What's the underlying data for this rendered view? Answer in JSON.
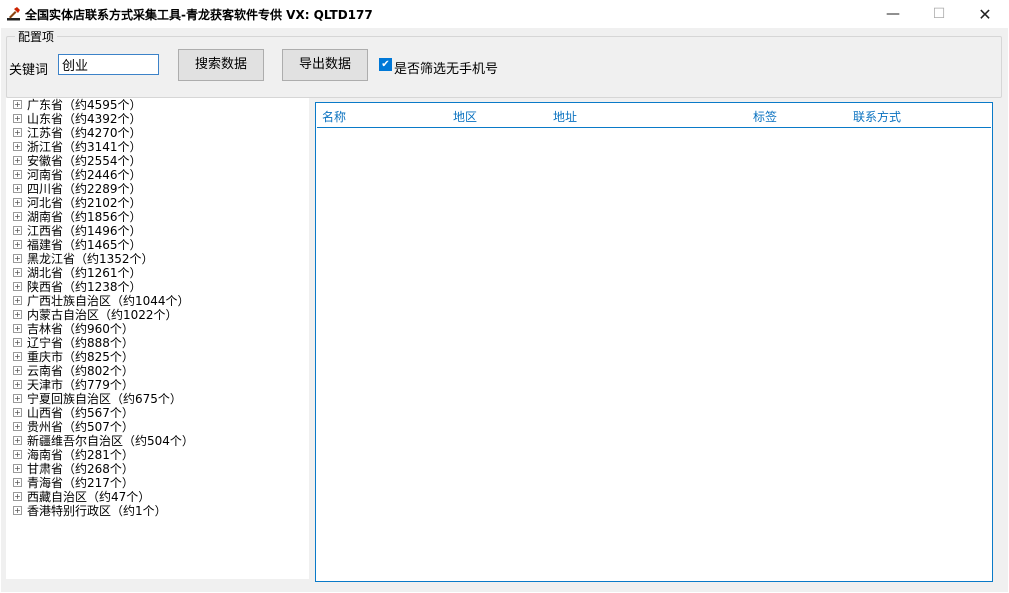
{
  "window": {
    "title": "全国实体店联系方式采集工具-青龙获客软件专供 VX:  QLTD177",
    "controls": {
      "minimize": "—",
      "maximize": "☐",
      "close": "✕"
    }
  },
  "config": {
    "group_title": "配置项",
    "keyword_label": "关键词",
    "keyword_value": "创业",
    "search_button": "搜索数据",
    "export_button": "导出数据",
    "filter_checkbox": {
      "label": "是否筛选无手机号",
      "checked": true
    }
  },
  "tree": {
    "expander_symbol": "+",
    "items": [
      "广东省（约4595个）",
      "山东省（约4392个）",
      "江苏省（约4270个）",
      "浙江省（约3141个）",
      "安徽省（约2554个）",
      "河南省（约2446个）",
      "四川省（约2289个）",
      "河北省（约2102个）",
      "湖南省（约1856个）",
      "江西省（约1496个）",
      "福建省（约1465个）",
      "黑龙江省（约1352个）",
      "湖北省（约1261个）",
      "陕西省（约1238个）",
      "广西壮族自治区（约1044个）",
      "内蒙古自治区（约1022个）",
      "吉林省（约960个）",
      "辽宁省（约888个）",
      "重庆市（约825个）",
      "云南省（约802个）",
      "天津市（约779个）",
      "宁夏回族自治区（约675个）",
      "山西省（约567个）",
      "贵州省（约507个）",
      "新疆维吾尔自治区（约504个）",
      "海南省（约281个）",
      "甘肃省（约268个）",
      "青海省（约217个）",
      "西藏自治区（约47个）",
      "香港特别行政区（约1个）"
    ]
  },
  "results": {
    "columns": [
      "名称",
      "地区",
      "地址",
      "标签",
      "联系方式"
    ],
    "rows": []
  },
  "colors": {
    "accent": "#0a7ac8",
    "header_text": "#0a72c0",
    "checkbox": "#0078d7"
  },
  "icons": {
    "app": "hammer-icon",
    "expander": "plus-box-icon",
    "checkmark": "checkmark-icon"
  }
}
